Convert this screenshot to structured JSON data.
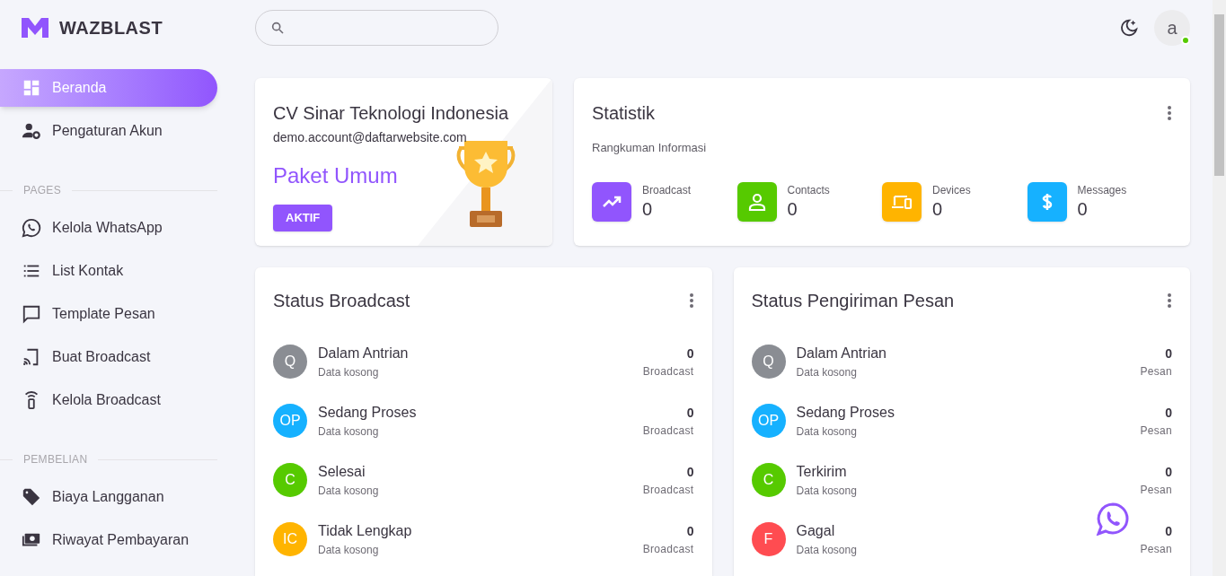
{
  "brand": {
    "name": "WAZBLAST"
  },
  "sidebar": {
    "sections": [
      {
        "items": [
          {
            "label": "Beranda",
            "kind": "dashboard",
            "selected": true
          },
          {
            "label": "Pengaturan Akun",
            "kind": "usergear",
            "selected": false
          }
        ]
      },
      {
        "heading": "PAGES",
        "items": [
          {
            "label": "Kelola WhatsApp",
            "kind": "whatsapp",
            "selected": false
          },
          {
            "label": "List Kontak",
            "kind": "list",
            "selected": false
          },
          {
            "label": "Template Pesan",
            "kind": "chat",
            "selected": false
          },
          {
            "label": "Buat Broadcast",
            "kind": "cast",
            "selected": false
          },
          {
            "label": "Kelola Broadcast",
            "kind": "signal",
            "selected": false
          }
        ]
      },
      {
        "heading": "PEMBELIAN",
        "items": [
          {
            "label": "Biaya Langganan",
            "kind": "tag",
            "selected": false
          },
          {
            "label": "Riwayat Pembayaran",
            "kind": "money",
            "selected": false
          }
        ]
      }
    ]
  },
  "header": {
    "avatar": "a",
    "online": true
  },
  "plan_card": {
    "company": "CV Sinar Teknologi Indonesia",
    "email": "demo.account@daftarwebsite.com",
    "plan": "Paket Umum",
    "status": "AKTIF"
  },
  "stats": {
    "title": "Statistik",
    "subtitle": "Rangkuman Informasi",
    "items": [
      {
        "label": "Broadcast",
        "value": "0",
        "kind": "trend",
        "color": "#9155fd"
      },
      {
        "label": "Contacts",
        "value": "0",
        "kind": "person",
        "color": "#56ca00"
      },
      {
        "label": "Devices",
        "value": "0",
        "kind": "devices",
        "color": "#ffb400"
      },
      {
        "label": "Messages",
        "value": "0",
        "kind": "dollar",
        "color": "#16b1ff"
      }
    ]
  },
  "status_cards": [
    {
      "title": "Status Broadcast",
      "rows": [
        {
          "initials": "Q",
          "color": "#8a8d93",
          "title": "Dalam Antrian",
          "subtitle": "Data kosong",
          "count": "0",
          "unit": "Broadcast"
        },
        {
          "initials": "OP",
          "color": "#16b1ff",
          "title": "Sedang Proses",
          "subtitle": "Data kosong",
          "count": "0",
          "unit": "Broadcast"
        },
        {
          "initials": "C",
          "color": "#56ca00",
          "title": "Selesai",
          "subtitle": "Data kosong",
          "count": "0",
          "unit": "Broadcast"
        },
        {
          "initials": "IC",
          "color": "#ffb400",
          "title": "Tidak Lengkap",
          "subtitle": "Data kosong",
          "count": "0",
          "unit": "Broadcast"
        }
      ]
    },
    {
      "title": "Status Pengiriman Pesan",
      "rows": [
        {
          "initials": "Q",
          "color": "#8a8d93",
          "title": "Dalam Antrian",
          "subtitle": "Data kosong",
          "count": "0",
          "unit": "Pesan"
        },
        {
          "initials": "OP",
          "color": "#16b1ff",
          "title": "Sedang Proses",
          "subtitle": "Data kosong",
          "count": "0",
          "unit": "Pesan"
        },
        {
          "initials": "C",
          "color": "#56ca00",
          "title": "Terkirim",
          "subtitle": "Data kosong",
          "count": "0",
          "unit": "Pesan"
        },
        {
          "initials": "F",
          "color": "#ff4c51",
          "title": "Gagal",
          "subtitle": "Data kosong",
          "count": "0",
          "unit": "Pesan"
        }
      ]
    }
  ]
}
